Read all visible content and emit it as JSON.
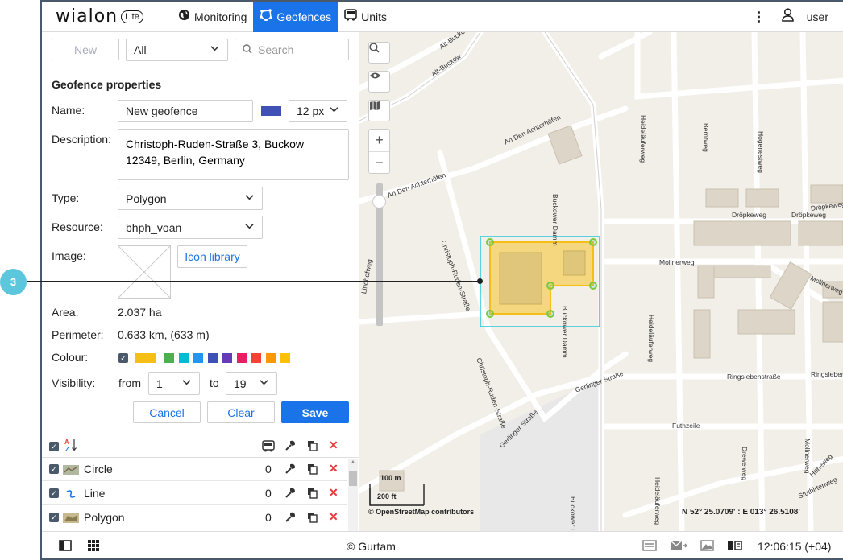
{
  "callout": {
    "number": "3"
  },
  "header": {
    "brand": "wialon",
    "edition": "Lite",
    "tabs": [
      {
        "label": "Monitoring",
        "icon": "globe-icon"
      },
      {
        "label": "Geofences",
        "icon": "geofence-icon",
        "active": true
      },
      {
        "label": "Units",
        "icon": "bus-icon"
      }
    ],
    "user": "user"
  },
  "toolbar": {
    "new_label": "New",
    "filter_value": "All",
    "search_placeholder": "Search"
  },
  "form": {
    "title": "Geofence properties",
    "name_label": "Name:",
    "name_value": "New geofence",
    "line_width": "12 px",
    "line_color": "#3f51b5",
    "description_label": "Description:",
    "description_value": "Christoph-Ruden-Straße 3, Buckow 12349, Berlin, Germany",
    "type_label": "Type:",
    "type_value": "Polygon",
    "resource_label": "Resource:",
    "resource_value": "bhph_voan",
    "image_label": "Image:",
    "icon_library": "Icon library",
    "area_label": "Area:",
    "area_value": "2.037 ha",
    "perimeter_label": "Perimeter:",
    "perimeter_value": "0.633 km, (633 m)",
    "colour_label": "Colour:",
    "selected_colour": "#f5bf16",
    "palette": [
      "#4caf50",
      "#00bcd4",
      "#2196f3",
      "#3f51b5",
      "#673ab7",
      "#e91e63",
      "#f44336",
      "#ff9800",
      "#ffc107"
    ],
    "visibility_label": "Visibility:",
    "from_label": "from",
    "from_value": "1",
    "to_label": "to",
    "to_value": "19",
    "cancel_label": "Cancel",
    "clear_label": "Clear",
    "save_label": "Save"
  },
  "list": {
    "items": [
      {
        "name": "Circle",
        "count": "0",
        "icon": "circle-geofence-icon"
      },
      {
        "name": "Line",
        "count": "0",
        "icon": "line-geofence-icon"
      },
      {
        "name": "Polygon",
        "count": "0",
        "icon": "polygon-geofence-icon"
      }
    ]
  },
  "map": {
    "streets": {
      "alt_buckow_1": "Alt-Buckow",
      "alt_buckow_2": "Alt-Buckow",
      "an_den_achterhofen_1": "An Den Achterhöfen",
      "an_den_achterhofen_2": "An Den Achterhöfen",
      "christoph_1": "Christoph-Ruden-Straße",
      "christoph_2": "Christoph-Ruden-Straße",
      "buckower_damm_1": "Buckower Damm",
      "buckower_damm_2": "Buckower Damm",
      "buckower_damm_3": "Buckower Damm",
      "heideläuferweg_1": "Heideläuferweg",
      "heideläuferweg_2": "Heideläuferweg",
      "heideläuferweg_3": "Heideläuferweg",
      "berntweg": "Berntweg",
      "hogenestweg": "Hogenestweg",
      "dropkeweg_1": "Dröpkeweg",
      "dropkeweg_2": "Dröpkeweg",
      "dropkeweg_3": "Dröpkeweg",
      "mollnerweg_1": "Mollnerweg",
      "mollnerweg_2": "Mollnerweg",
      "ringslebenstrasse_1": "Ringslebenstraße",
      "ringslebenstrasse_2": "Ringslebenstraße",
      "gerlinger_1": "Gerlinger Straße",
      "gerlinger_2": "Gerlinger Straße",
      "futhzeile": "Futhzeile",
      "drewelweg": "Drewelweg",
      "mollnerweg_v": "Mollnerweg",
      "stuthirtenweg": "Stuthirtenweg",
      "hoheweg": "Hoheweg",
      "lindhofweg": "Lindhofweg"
    },
    "scale_1": "100 m",
    "scale_2": "200 ft",
    "attribution": "© OpenStreetMap contributors",
    "coords": "N 52° 25.0709' : E 013° 26.5108'"
  },
  "footer": {
    "copyright": "© Gurtam",
    "time": "12:06:15 (+04)"
  }
}
